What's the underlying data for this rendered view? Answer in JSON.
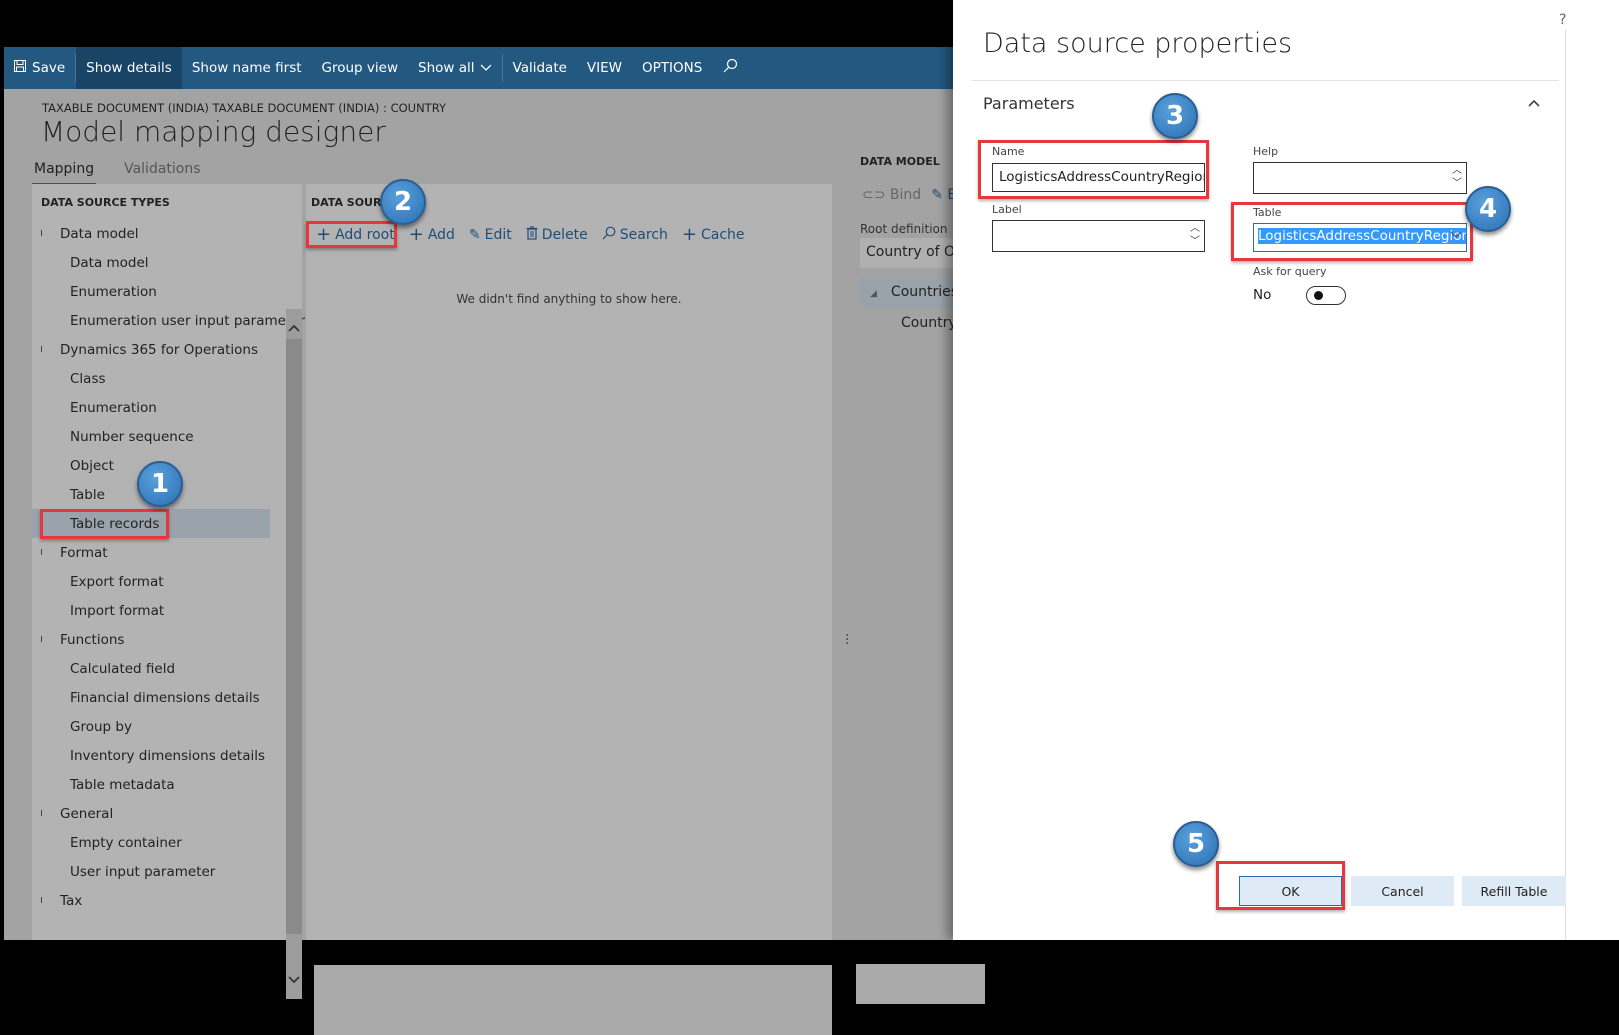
{
  "toolbar": {
    "items": [
      {
        "label": "Save",
        "icon": "save-icon"
      },
      {
        "label": "Show details"
      },
      {
        "label": "Show name first"
      },
      {
        "label": "Group view"
      },
      {
        "label": "Show all"
      },
      {
        "label": "Validate"
      },
      {
        "label": "VIEW"
      },
      {
        "label": "OPTIONS"
      }
    ],
    "search_icon": "⚲"
  },
  "page": {
    "breadcrumb": "TAXABLE DOCUMENT (INDIA) TAXABLE DOCUMENT (INDIA) : COUNTRY",
    "title": "Model mapping designer",
    "tabs": [
      {
        "label": "Mapping",
        "active": true
      },
      {
        "label": "Validations",
        "active": false
      }
    ]
  },
  "data_source_types": {
    "header": "DATA SOURCE TYPES",
    "groups": [
      {
        "label": "Data model",
        "children": [
          "Data model",
          "Enumeration",
          "Enumeration user input parameter"
        ]
      },
      {
        "label": "Dynamics 365 for Operations",
        "children": [
          "Class",
          "Enumeration",
          "Number sequence",
          "Object",
          "Table",
          "Table records"
        ]
      },
      {
        "label": "Format",
        "children": [
          "Export format",
          "Import format"
        ]
      },
      {
        "label": "Functions",
        "children": [
          "Calculated field",
          "Financial dimensions details",
          "Group by",
          "Inventory dimensions details",
          "Table metadata"
        ]
      },
      {
        "label": "General",
        "children": [
          "Empty container",
          "User input parameter"
        ]
      },
      {
        "label": "Tax",
        "children": []
      }
    ],
    "selected": "Table records"
  },
  "data_sources": {
    "header": "DATA SOURCES",
    "actions": [
      {
        "label": "Add root",
        "icon": "+"
      },
      {
        "label": "Add",
        "icon": "+"
      },
      {
        "label": "Edit",
        "icon": "✎"
      },
      {
        "label": "Delete",
        "icon": "🗑"
      },
      {
        "label": "Search",
        "icon": "⚲"
      },
      {
        "label": "Cache",
        "icon": "+"
      }
    ],
    "empty_message": "We didn't find anything to show here."
  },
  "data_model": {
    "header": "DATA MODEL",
    "bind_label": "Bind",
    "edit_label": "E",
    "root_definition_label": "Root definition",
    "root_definition_value": "Country of Ori",
    "tree": [
      {
        "label": "Countries",
        "expanded": true
      },
      {
        "label": "Country"
      }
    ]
  },
  "dialog": {
    "title": "Data source properties",
    "help": "?",
    "section": "Parameters",
    "fields": {
      "name": {
        "label": "Name",
        "value": "LogisticsAddressCountryRegion"
      },
      "label": {
        "label": "Label",
        "value": ""
      },
      "help": {
        "label": "Help",
        "value": ""
      },
      "table": {
        "label": "Table",
        "value": "LogisticsAddressCountryRegion"
      },
      "ask_for_query": {
        "label": "Ask for query",
        "value": "No"
      }
    },
    "buttons": {
      "ok": "OK",
      "cancel": "Cancel",
      "refill": "Refill Table"
    }
  },
  "callouts": [
    "1",
    "2",
    "3",
    "4",
    "5"
  ],
  "colors": {
    "toolbar": "#235881",
    "highlight": "#e8363d",
    "badge": "#3a86c8"
  }
}
